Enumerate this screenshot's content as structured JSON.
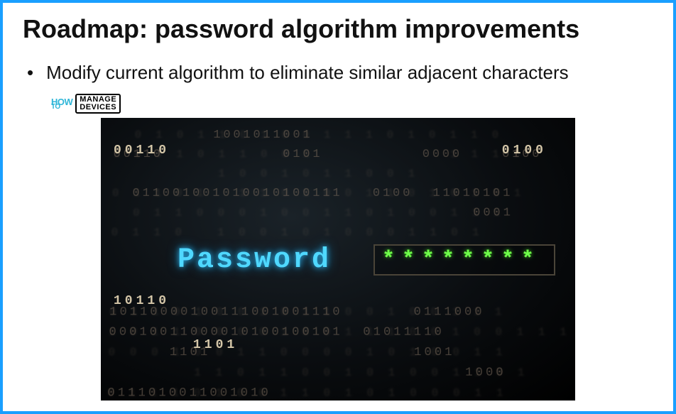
{
  "title": "Roadmap: password algorithm improvements",
  "bullet": {
    "marker": "•",
    "text": "Modify current algorithm to eliminate similar adjacent characters"
  },
  "badge": {
    "how": "HOW",
    "to": "TO",
    "line1": "MANAGE",
    "line2": "DEVICES"
  },
  "hero": {
    "password_label": "Password",
    "password_mask": "********",
    "binary_back": "  0 1 0 1 1 0 1 0 0 1 1 1 0 1 0 1 1 0\n1 0 0 1 0 1 1 0 0 1             1 1 1 0\n          1 0 0 1 0 1 1 0 0 1\n0 1 1 0 1   1 1 0 1 0 0 1 1 0 1 0 1 0 1\n  0 1 1 0 0 0 1 0 0 1 1 0 1 0 0 1 1 1\n0 1 1 0   1 0 0 1 0 1 0 0 0 1 1 0 1\n\n\n\n0 1 1 0 1 0 0 1 0 1 1 0 0 1 0 0 1 1 1\n1 0 1 1 0 0 0 0 1 0 0 1 1 1 0 0 1 0 0 1 1 1\n0 0 0 1 0 0 1 1 0 0 0 0 1 0 1 0 0 1 1\n        1 1 0 1 1 0 0 1 0 1 0 0 1 1 0 1\n0 1 1 1 0 1 0 0 1 1 0 1 0 1 0 0 0 1 1",
    "binary_front": "          1001011001\n00110            0101          0000    0100\n\n  011001001010010100111   0100  11010101\n                                    0001\n\n\n\n\n10110000100111001001110       0111000\n00010011000010100100101  01011110\n      1101                    1001\n                                   1000\n0111010011001010",
    "hl1": "00110",
    "hl2": "0100",
    "hl3": "10110",
    "hl4": "1101"
  }
}
